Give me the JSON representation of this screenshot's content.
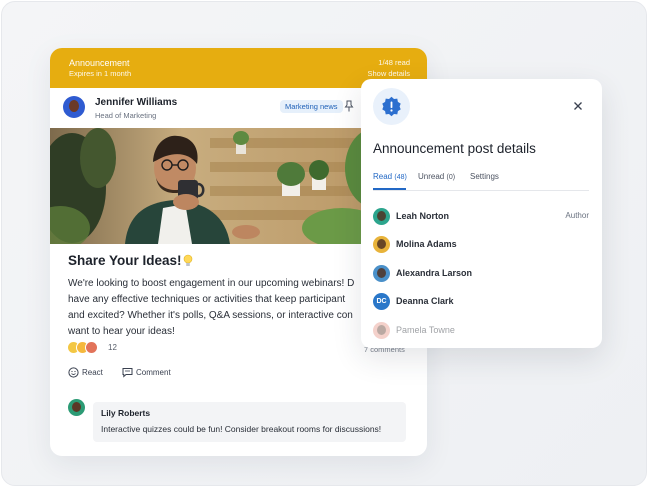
{
  "announcement": {
    "banner_title": "Announcement",
    "banner_expiry": "Expires in 1 month",
    "read_count": "1/48 read",
    "show_details": "Show details",
    "author_name": "Jennifer Williams",
    "author_role": "Head of Marketing",
    "tag": "Marketing news",
    "post_title": "Share Your Ideas!",
    "body_lines": [
      "We're looking to boost engagement in our upcoming webinars! D",
      "have any effective techniques or activities that keep participant",
      "and excited? Whether it's polls, Q&A sessions, or interactive con",
      "want to hear your ideas!"
    ],
    "reaction_count": "12",
    "comments_count": "7 comments",
    "react_label": "React",
    "comment_label": "Comment"
  },
  "comment": {
    "author": "Lily Roberts",
    "text": "Interactive quizzes could be fun! Consider breakout rooms for discussions!"
  },
  "details_panel": {
    "title": "Announcement post details",
    "tabs": [
      {
        "label": "Read",
        "count": "(48)"
      },
      {
        "label": "Unread",
        "count": "(0)"
      },
      {
        "label": "Settings",
        "count": ""
      }
    ],
    "readers": [
      {
        "name": "Leah Norton",
        "role": "Author",
        "avatar_color": "#2ca58d"
      },
      {
        "name": "Molina Adams",
        "role": "",
        "avatar_color": "#e8b33a"
      },
      {
        "name": "Alexandra Larson",
        "role": "",
        "avatar_color": "#4a90c9"
      },
      {
        "name": "Deanna Clark",
        "role": "",
        "initials": "DC",
        "avatar_color": "#2a77c9"
      },
      {
        "name": "Pamela Towne",
        "role": "",
        "avatar_color": "#e79a8c"
      }
    ]
  },
  "colors": {
    "banner": "#e6ad10",
    "accent_blue": "#2268c5",
    "tag_bg": "#e6f0fb"
  },
  "icons": {
    "pin": "pin-icon",
    "bulb": "lightbulb-icon",
    "react": "smiley-icon",
    "comment": "comment-bubble-icon",
    "close": "close-icon",
    "alert": "alert-badge-icon"
  }
}
